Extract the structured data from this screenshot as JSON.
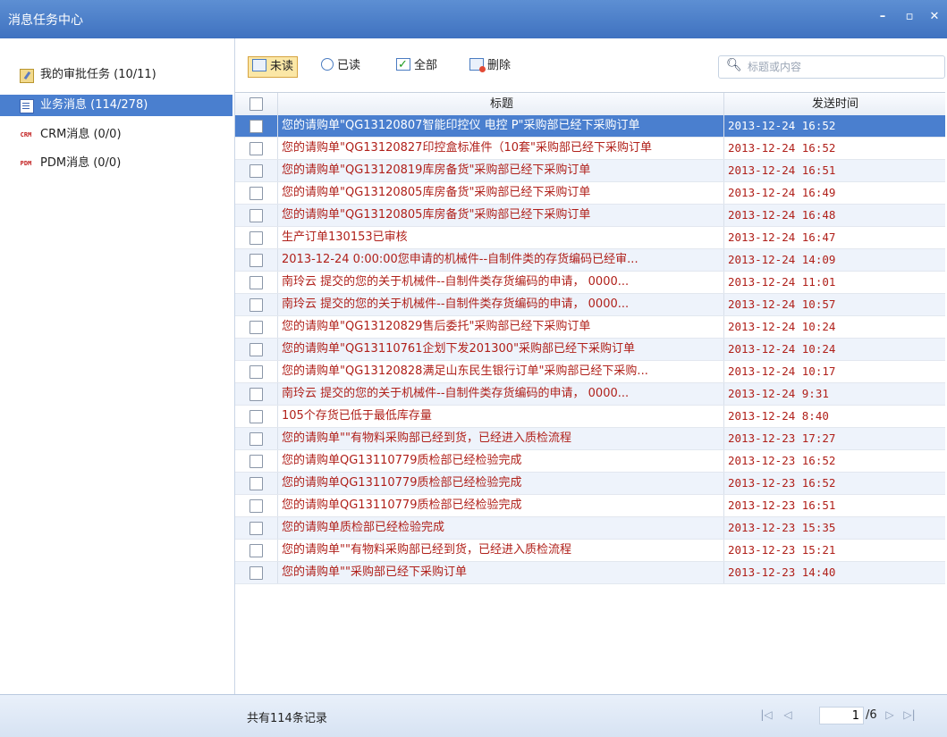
{
  "window": {
    "title": "消息任务中心",
    "minimize": "–",
    "maximize": "▫",
    "close": "✕"
  },
  "sidebar": {
    "items": [
      {
        "label": "我的审批任务 (10/11)",
        "icon": "task-icon",
        "selected": false
      },
      {
        "label": "业务消息 (114/278)",
        "icon": "message-icon",
        "selected": true
      },
      {
        "label": "CRM消息 (0/0)",
        "icon": "crm-icon",
        "icon_text": "CRM",
        "selected": false
      },
      {
        "label": "PDM消息 (0/0)",
        "icon": "pdm-icon",
        "icon_text": "PDM",
        "selected": false
      }
    ]
  },
  "toolbar": {
    "unread": "未读",
    "read": "已读",
    "all": "全部",
    "delete": "删除",
    "search_placeholder": "标题或内容"
  },
  "table": {
    "headers": {
      "title": "标题",
      "time": "发送时间"
    },
    "rows": [
      {
        "title": "您的请购单\"QG13120807智能印控仪 电控 P\"采购部已经下采购订单",
        "time": "2013-12-24 16:52"
      },
      {
        "title": "您的请购单\"QG13120827印控盒标准件（10套\"采购部已经下采购订单",
        "time": "2013-12-24 16:52"
      },
      {
        "title": "您的请购单\"QG13120819库房备货\"采购部已经下采购订单",
        "time": "2013-12-24 16:51"
      },
      {
        "title": "您的请购单\"QG13120805库房备货\"采购部已经下采购订单",
        "time": "2013-12-24 16:49"
      },
      {
        "title": "您的请购单\"QG13120805库房备货\"采购部已经下采购订单",
        "time": "2013-12-24 16:48"
      },
      {
        "title": "生产订单130153已审核",
        "time": "2013-12-24 16:47"
      },
      {
        "title": "2013-12-24 0:00:00您申请的机械件--自制件类的存货编码已经审...",
        "time": "2013-12-24 14:09"
      },
      {
        "title": "南玲云 提交的您的关于机械件--自制件类存货编码的申请， 0000...",
        "time": "2013-12-24 11:01"
      },
      {
        "title": "南玲云 提交的您的关于机械件--自制件类存货编码的申请， 0000...",
        "time": "2013-12-24 10:57"
      },
      {
        "title": "您的请购单\"QG13120829售后委托\"采购部已经下采购订单",
        "time": "2013-12-24 10:24"
      },
      {
        "title": "您的请购单\"QG13110761企划下发201300\"采购部已经下采购订单",
        "time": "2013-12-24 10:24"
      },
      {
        "title": "您的请购单\"QG13120828满足山东民生银行订单\"采购部已经下采购...",
        "time": "2013-12-24 10:17"
      },
      {
        "title": "南玲云 提交的您的关于机械件--自制件类存货编码的申请， 0000...",
        "time": "2013-12-24 9:31"
      },
      {
        "title": "105个存货已低于最低库存量",
        "time": "2013-12-24 8:40"
      },
      {
        "title": "您的请购单\"\"有物料采购部已经到货，已经进入质检流程",
        "time": "2013-12-23 17:27"
      },
      {
        "title": "您的请购单QG13110779质检部已经检验完成",
        "time": "2013-12-23 16:52"
      },
      {
        "title": "您的请购单QG13110779质检部已经检验完成",
        "time": "2013-12-23 16:52"
      },
      {
        "title": "您的请购单QG13110779质检部已经检验完成",
        "time": "2013-12-23 16:51"
      },
      {
        "title": "您的请购单质检部已经检验完成",
        "time": "2013-12-23 15:35"
      },
      {
        "title": "您的请购单\"\"有物料采购部已经到货，已经进入质检流程",
        "time": "2013-12-23 15:21"
      },
      {
        "title": "您的请购单\"\"采购部已经下采购订单",
        "time": "2013-12-23 14:40"
      }
    ],
    "selected_row": 0
  },
  "status": {
    "count": "共有114条记录",
    "page": "1",
    "total": "/6"
  },
  "colors": {
    "titlebar": "#4a7fcf",
    "selection": "#4a7fcf",
    "unread_text": "#b0201a",
    "alt_row": "#eef3fb"
  }
}
